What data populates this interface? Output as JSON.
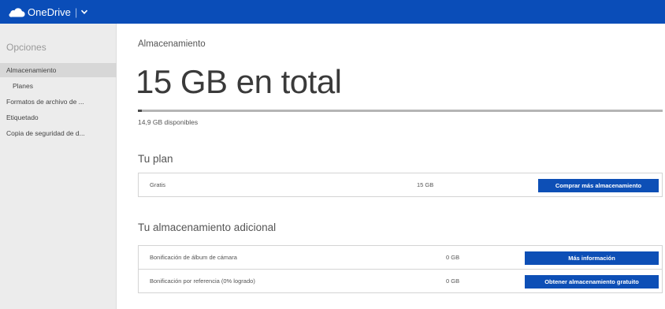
{
  "app": {
    "name": "OneDrive",
    "separator": "|",
    "brand_color": "#0a4db8",
    "icons": [
      "cloud-icon",
      "chevron-down-icon"
    ]
  },
  "sidebar": {
    "title": "Opciones",
    "items": [
      {
        "label": "Almacenamiento",
        "selected": true
      },
      {
        "label": "Planes",
        "selected": false
      },
      {
        "label": "Formatos de archivo de ...",
        "selected": false
      },
      {
        "label": "Etiquetado",
        "selected": false
      },
      {
        "label": "Copia de seguridad de d...",
        "selected": false
      }
    ]
  },
  "main": {
    "heading": "Almacenamiento",
    "total": "15 GB en total",
    "used_fraction": 0.007,
    "available": "14,9 GB disponibles",
    "plan": {
      "title": "Tu plan",
      "rows": [
        {
          "name": "Gratis",
          "size": "15 GB",
          "button": "Comprar más almacenamiento"
        }
      ]
    },
    "additional": {
      "title": "Tu almacenamiento adicional",
      "rows": [
        {
          "name": "Bonificación de álbum de cámara",
          "size": "0 GB",
          "button": "Más información"
        },
        {
          "name": "Bonificación por referencia (0% logrado)",
          "size": "0 GB",
          "button": "Obtener almacenamiento gratuito"
        }
      ]
    },
    "accent_color": "#0d4fb6"
  }
}
